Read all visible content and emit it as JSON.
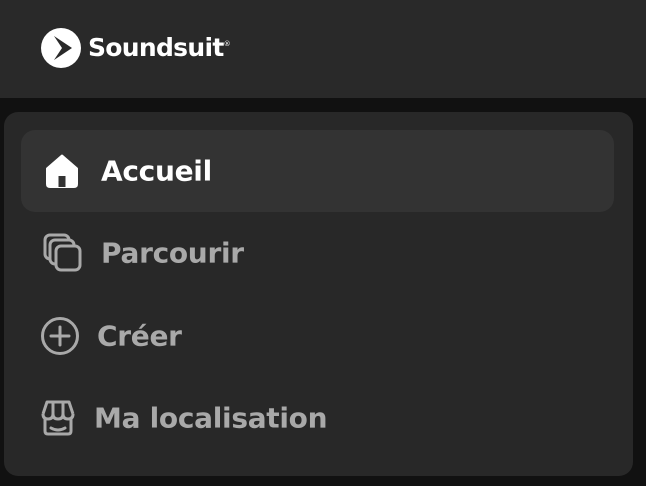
{
  "brand": {
    "name": "Soundsuit",
    "trademark": "®"
  },
  "nav": {
    "items": [
      {
        "label": "Accueil",
        "icon": "home-icon",
        "active": true
      },
      {
        "label": "Parcourir",
        "icon": "stacked-squares-icon",
        "active": false
      },
      {
        "label": "Créer",
        "icon": "plus-circle-icon",
        "active": false
      },
      {
        "label": "Ma localisation",
        "icon": "store-icon",
        "active": false
      }
    ]
  },
  "colors": {
    "header_bg": "#292929",
    "page_bg": "#111111",
    "panel_bg": "#282828",
    "active_item_bg": "#333333",
    "active_text": "#ffffff",
    "inactive_text": "#a9a9a9"
  }
}
